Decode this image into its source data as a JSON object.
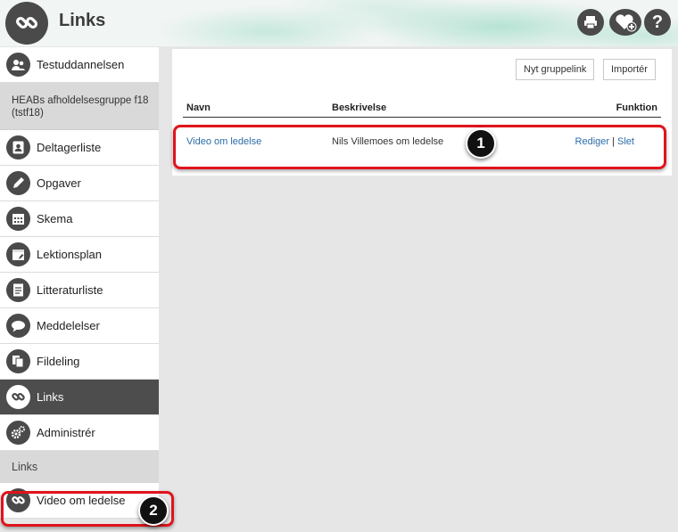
{
  "header": {
    "title": "Links",
    "icons": [
      "link-icon",
      "print-icon",
      "favorite-add-icon",
      "help-icon"
    ],
    "help_glyph": "?"
  },
  "sidebar": {
    "course": "Testuddannelsen",
    "group": "HEABs afholdelsesgruppe f18 (tstf18)",
    "items": [
      {
        "label": "Deltagerliste",
        "icon": "contact-card-icon"
      },
      {
        "label": "Opgaver",
        "icon": "pencil-icon"
      },
      {
        "label": "Skema",
        "icon": "calendar-grid-icon"
      },
      {
        "label": "Lektionsplan",
        "icon": "calendar-edit-icon"
      },
      {
        "label": "Litteraturliste",
        "icon": "document-list-icon"
      },
      {
        "label": "Meddelelser",
        "icon": "speech-bubble-icon"
      },
      {
        "label": "Fildeling",
        "icon": "files-icon"
      },
      {
        "label": "Links",
        "icon": "link-icon",
        "active": true
      },
      {
        "label": "Administrér",
        "icon": "gears-icon"
      }
    ],
    "sub_header": "Links",
    "sub_items": [
      {
        "label": "Video om ledelse",
        "icon": "link-icon"
      }
    ]
  },
  "toolbar": {
    "new_group_link": "Nyt gruppelink",
    "import": "Importér"
  },
  "table": {
    "columns": [
      "Navn",
      "Beskrivelse",
      "Funktion"
    ],
    "rows": [
      {
        "name": "Video om ledelse",
        "description": "Nils Villemoes om ledelse",
        "edit": "Rediger",
        "separator": "|",
        "delete": "Slet"
      }
    ]
  },
  "annotations": {
    "badge1": "1",
    "badge2": "2",
    "highlight_color": "#e0141c"
  }
}
